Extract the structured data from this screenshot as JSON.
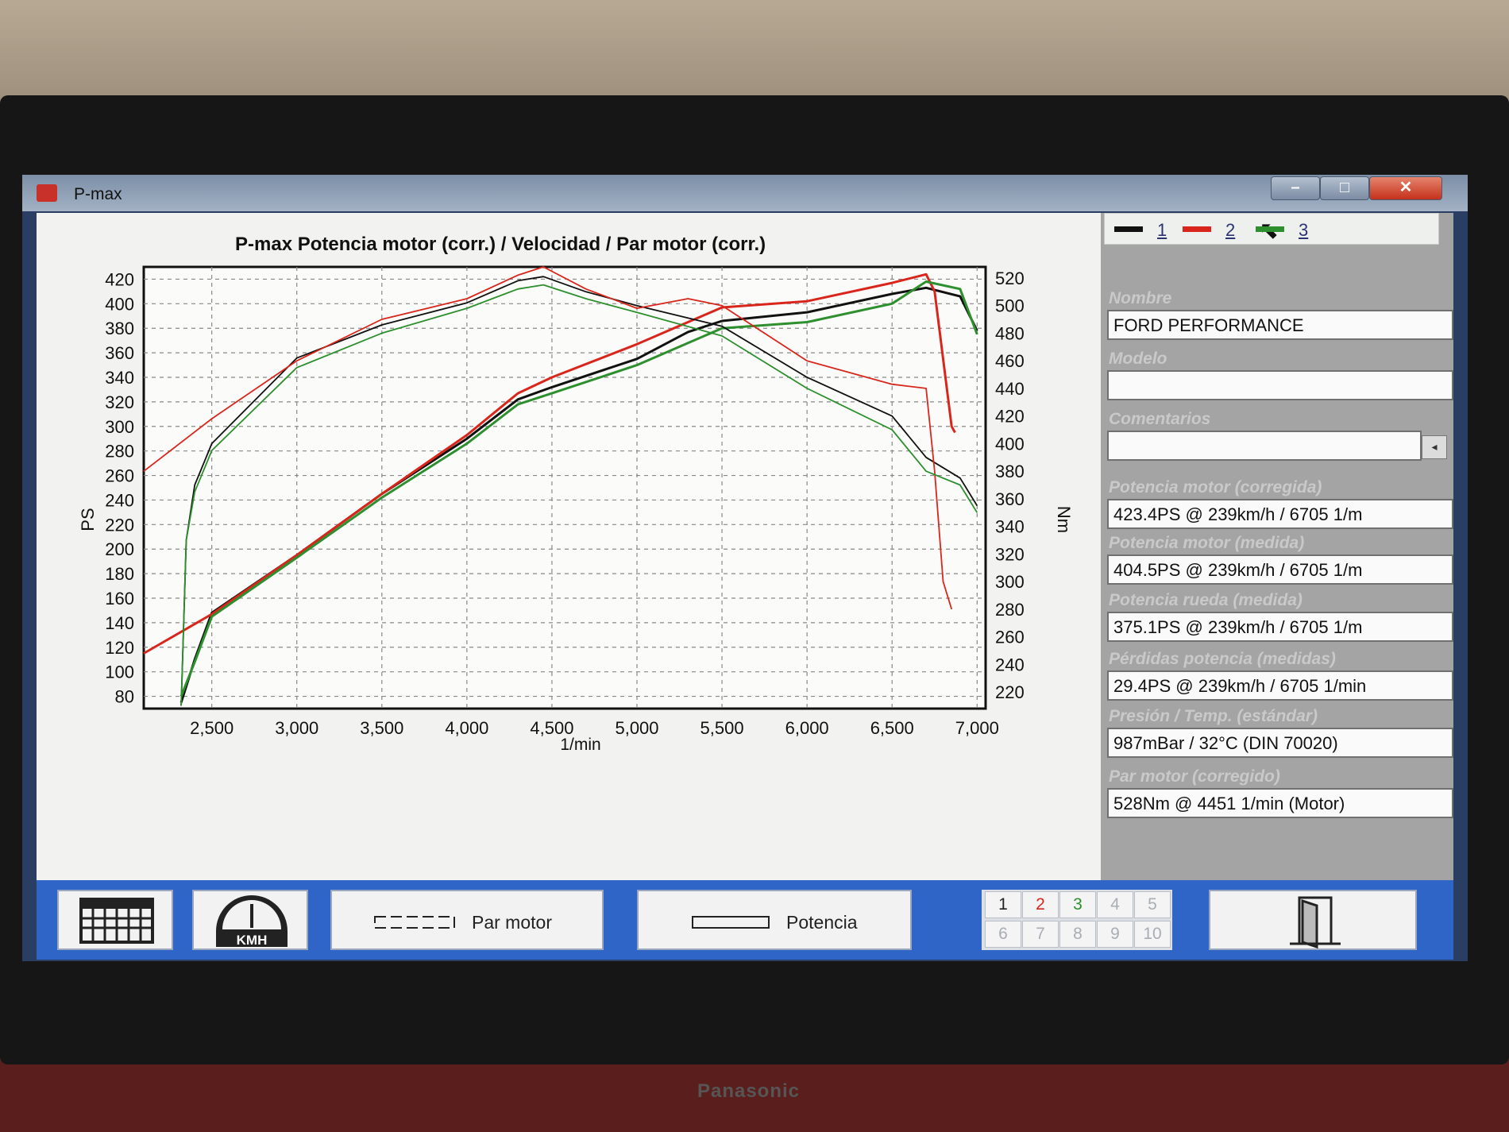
{
  "window": {
    "title": "P-max",
    "controls": [
      "minimize",
      "maximize",
      "close"
    ]
  },
  "monitor": {
    "brand": "Panasonic"
  },
  "colors": {
    "run1": "#111111",
    "run2": "#d9261c",
    "run3": "#2d8f2d",
    "accent": "#2f65c7"
  },
  "legend": {
    "items": [
      {
        "label": "1"
      },
      {
        "label": "2"
      },
      {
        "label": "3"
      }
    ]
  },
  "side_panel": {
    "nombre": {
      "label": "Nombre",
      "value": "FORD PERFORMANCE"
    },
    "modelo": {
      "label": "Modelo",
      "value": ""
    },
    "comentarios": {
      "label": "Comentarios",
      "value": ""
    },
    "potencia_corregida": {
      "label": "Potencia motor (corregida)",
      "value": "423.4PS @ 239km/h / 6705 1/m"
    },
    "potencia_medida": {
      "label": "Potencia motor (medida)",
      "value": "404.5PS @ 239km/h / 6705 1/m"
    },
    "potencia_rueda": {
      "label": "Potencia rueda (medida)",
      "value": "375.1PS @ 239km/h / 6705 1/m"
    },
    "perdidas": {
      "label": "Pérdidas potencia (medidas)",
      "value": "29.4PS @ 239km/h / 6705 1/min"
    },
    "presion": {
      "label": "Presión / Temp. (estándar)",
      "value": "987mBar / 32°C (DIN 70020)"
    },
    "par": {
      "label": "Par motor (corregido)",
      "value": "528Nm @ 4451 1/min (Motor)"
    }
  },
  "toolbar": {
    "kmh_label": "KMH",
    "par_label": "Par motor",
    "potencia_label": "Potencia",
    "run_numbers": [
      "1",
      "2",
      "3",
      "4",
      "5",
      "6",
      "7",
      "8",
      "9",
      "10"
    ],
    "run_number_colors": [
      "#222222",
      "#d9261c",
      "#2d8f2d",
      "#a9adb4",
      "#a9adb4",
      "#a9adb4",
      "#a9adb4",
      "#a9adb4",
      "#a9adb4",
      "#a9adb4"
    ]
  },
  "chart_data": {
    "type": "line",
    "title": "P-max Potencia motor (corr.) / Velocidad / Par motor (corr.)",
    "xlabel": "1/min",
    "ylabel": "PS",
    "y2label": "Nm",
    "xlim": [
      2100,
      7050
    ],
    "ylim": [
      70,
      430
    ],
    "y2lim": [
      208,
      528
    ],
    "xticks": [
      "2,500",
      "3,000",
      "3,500",
      "4,000",
      "4,500",
      "5,000",
      "5,500",
      "6,000",
      "6,500",
      "7,000"
    ],
    "yticks": [
      "80",
      "100",
      "120",
      "140",
      "160",
      "180",
      "200",
      "220",
      "240",
      "260",
      "280",
      "300",
      "320",
      "340",
      "360",
      "380",
      "400",
      "420"
    ],
    "y2ticks": [
      "220",
      "240",
      "260",
      "280",
      "300",
      "320",
      "340",
      "360",
      "380",
      "400",
      "420",
      "440",
      "460",
      "480",
      "500",
      "520"
    ],
    "grid": true,
    "series": [
      {
        "name": "1",
        "metric": "Potencia",
        "axis": "PS",
        "x": [
          2320,
          2400,
          2500,
          3000,
          3500,
          4000,
          4300,
          4500,
          5000,
          5300,
          5500,
          6000,
          6500,
          6700,
          6900,
          7000
        ],
        "y": [
          75,
          110,
          148,
          195,
          245,
          290,
          322,
          332,
          355,
          377,
          386,
          393,
          408,
          413,
          406,
          378
        ]
      },
      {
        "name": "2",
        "metric": "Potencia",
        "axis": "PS",
        "x": [
          2100,
          2500,
          3000,
          3500,
          4000,
          4300,
          4500,
          5000,
          5500,
          6000,
          6500,
          6700,
          6750,
          6850,
          6870
        ],
        "y": [
          115,
          147,
          195,
          245,
          293,
          327,
          340,
          367,
          397,
          402,
          417,
          424,
          410,
          300,
          295
        ]
      },
      {
        "name": "3",
        "metric": "Potencia",
        "axis": "PS",
        "x": [
          2320,
          2400,
          2500,
          3000,
          3500,
          4000,
          4300,
          4500,
          5000,
          5300,
          5500,
          6000,
          6500,
          6700,
          6900,
          7000
        ],
        "y": [
          80,
          108,
          145,
          193,
          242,
          286,
          318,
          327,
          350,
          368,
          380,
          385,
          400,
          418,
          412,
          375
        ]
      },
      {
        "name": "1",
        "metric": "Par motor",
        "axis": "Nm",
        "x": [
          2320,
          2350,
          2400,
          2500,
          3000,
          3500,
          4000,
          4300,
          4450,
          4700,
          5000,
          5500,
          6000,
          6500,
          6700,
          6900,
          7000
        ],
        "y": [
          210,
          330,
          370,
          400,
          462,
          486,
          502,
          518,
          521,
          510,
          500,
          485,
          448,
          420,
          390,
          375,
          355
        ]
      },
      {
        "name": "2",
        "metric": "Par motor",
        "axis": "Nm",
        "x": [
          2100,
          2500,
          3000,
          3500,
          4000,
          4300,
          4450,
          4700,
          5000,
          5300,
          5500,
          6000,
          6500,
          6700,
          6750,
          6800,
          6850
        ],
        "y": [
          380,
          418,
          460,
          490,
          505,
          522,
          528,
          512,
          498,
          505,
          500,
          460,
          443,
          440,
          380,
          300,
          280
        ]
      },
      {
        "name": "3",
        "metric": "Par motor",
        "axis": "Nm",
        "x": [
          2320,
          2350,
          2400,
          2500,
          3000,
          3500,
          4000,
          4300,
          4450,
          4700,
          5000,
          5500,
          6000,
          6500,
          6700,
          6900,
          7000
        ],
        "y": [
          210,
          330,
          365,
          395,
          455,
          480,
          498,
          512,
          515,
          505,
          495,
          478,
          440,
          410,
          380,
          370,
          350
        ]
      }
    ]
  }
}
